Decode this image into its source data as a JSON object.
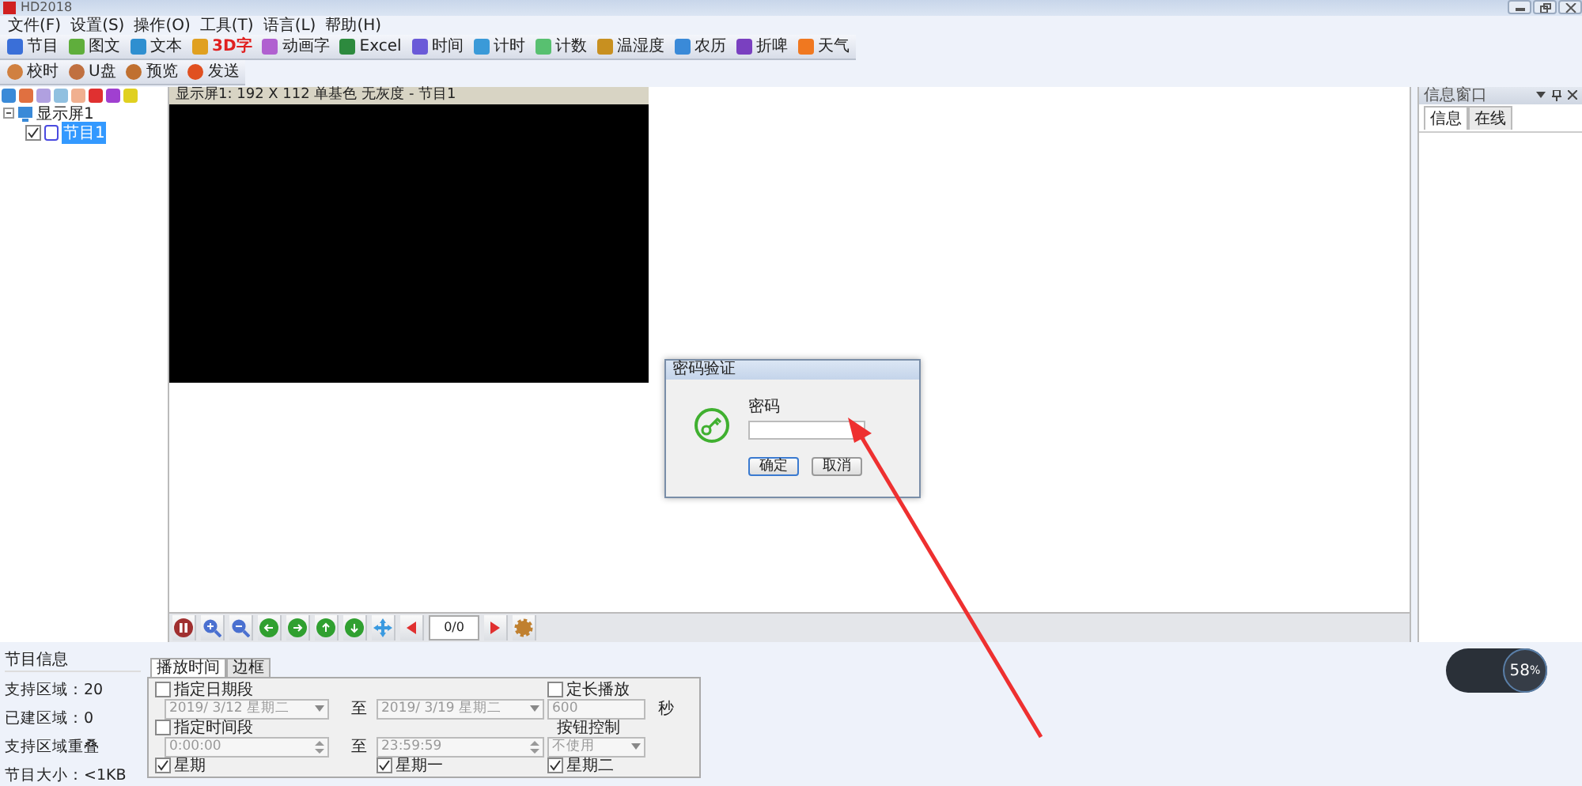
{
  "window": {
    "title": "HD2018"
  },
  "menu": [
    "文件(F)",
    "设置(S)",
    "操作(O)",
    "工具(T)",
    "语言(L)",
    "帮助(H)"
  ],
  "toolbar_main": [
    {
      "label": "节目",
      "emphasis": false
    },
    {
      "label": "图文",
      "emphasis": false
    },
    {
      "label": "文本",
      "emphasis": false
    },
    {
      "label": "3D字",
      "emphasis": true
    },
    {
      "label": "动画字",
      "emphasis": false
    },
    {
      "label": "Excel",
      "emphasis": false
    },
    {
      "label": "时间",
      "emphasis": false
    },
    {
      "label": "计时",
      "emphasis": false
    },
    {
      "label": "计数",
      "emphasis": false
    },
    {
      "label": "温湿度",
      "emphasis": false
    },
    {
      "label": "农历",
      "emphasis": false
    },
    {
      "label": "折啤",
      "emphasis": false
    },
    {
      "label": "天气",
      "emphasis": false
    }
  ],
  "toolbar_secondary": [
    {
      "label": "校时"
    },
    {
      "label": "U盘"
    },
    {
      "label": "预览"
    },
    {
      "label": "发送"
    }
  ],
  "tree": [
    {
      "label": "显示屏1",
      "expanded": true,
      "children": [
        {
          "label": "节目1",
          "checked": true,
          "selected": true
        }
      ]
    }
  ],
  "canvas": {
    "header": "显示屏1: 192 X 112  单基色 无灰度 - 节目1"
  },
  "playback_toolbar": {
    "counter": "0/0"
  },
  "info_window": {
    "title": "信息窗口",
    "tabs": [
      {
        "label": "信息",
        "selected": true
      },
      {
        "label": "在线",
        "selected": false
      }
    ]
  },
  "program_info": {
    "title": "节目信息",
    "lines": [
      "支持区域：20",
      "已建区域：0",
      "支持区域重叠",
      "节目大小：<1KB"
    ]
  },
  "properties": {
    "tabs": [
      {
        "label": "播放时间",
        "selected": true
      },
      {
        "label": "边框",
        "selected": false
      }
    ],
    "date_range": {
      "label": "指定日期段",
      "checked": false,
      "start": "2019/ 3/12 星期二",
      "to": "至",
      "end": "2019/ 3/19 星期二"
    },
    "fixed_length": {
      "label": "定长播放",
      "checked": false,
      "value": "600",
      "unit": "秒"
    },
    "time_range": {
      "label": "指定时间段",
      "checked": false,
      "start": "0:00:00",
      "to": "至",
      "end": "23:59:59"
    },
    "button_control": {
      "label": "按钮控制",
      "value": "不使用"
    },
    "weekdays": [
      {
        "label": "星期",
        "checked": true
      },
      {
        "label": "星期一",
        "checked": true
      },
      {
        "label": "星期二",
        "checked": true
      }
    ]
  },
  "dialog": {
    "title": "密码验证",
    "label": "密码",
    "ok": "确定",
    "cancel": "取消"
  },
  "speed_widget": {
    "value": "58",
    "unit": "%"
  }
}
